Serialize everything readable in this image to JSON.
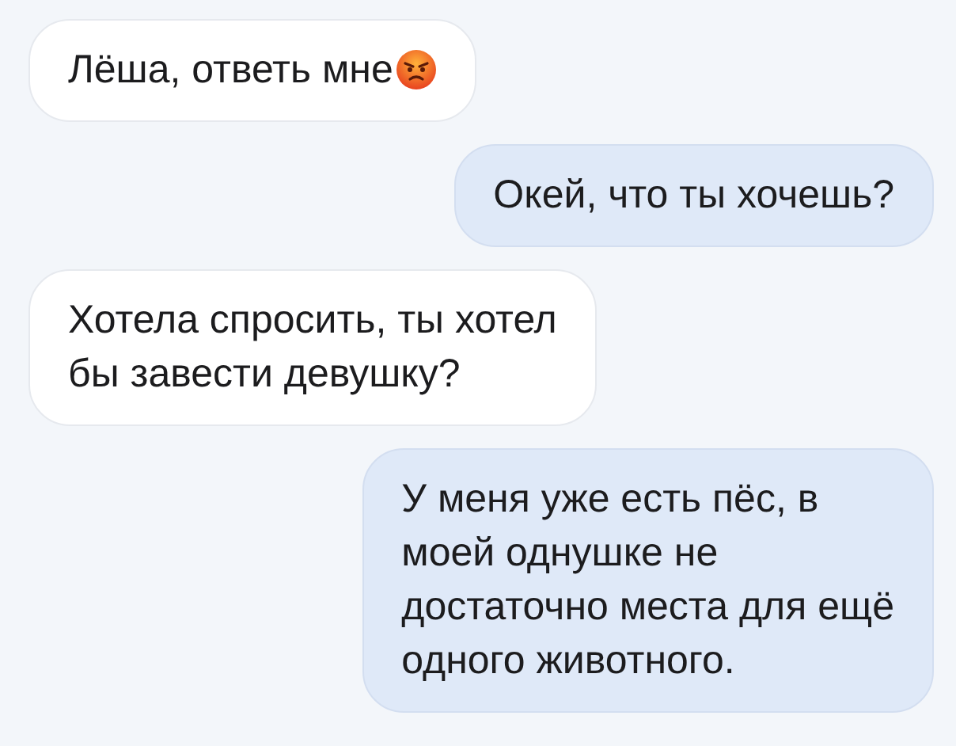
{
  "messages": [
    {
      "sent": false,
      "text": "Лёша, ответь мне",
      "trailing_icon": true
    },
    {
      "sent": true,
      "text": "Окей, что ты хочешь?",
      "trailing_icon": false
    },
    {
      "sent": false,
      "text": "Хотела спросить, ты хотел\nбы завести девушку?",
      "trailing_icon": false
    },
    {
      "sent": true,
      "text": "У меня уже есть пёс, в\nмоей однушке не\nдостаточно места для ещё\nодного животного.",
      "trailing_icon": false
    }
  ]
}
